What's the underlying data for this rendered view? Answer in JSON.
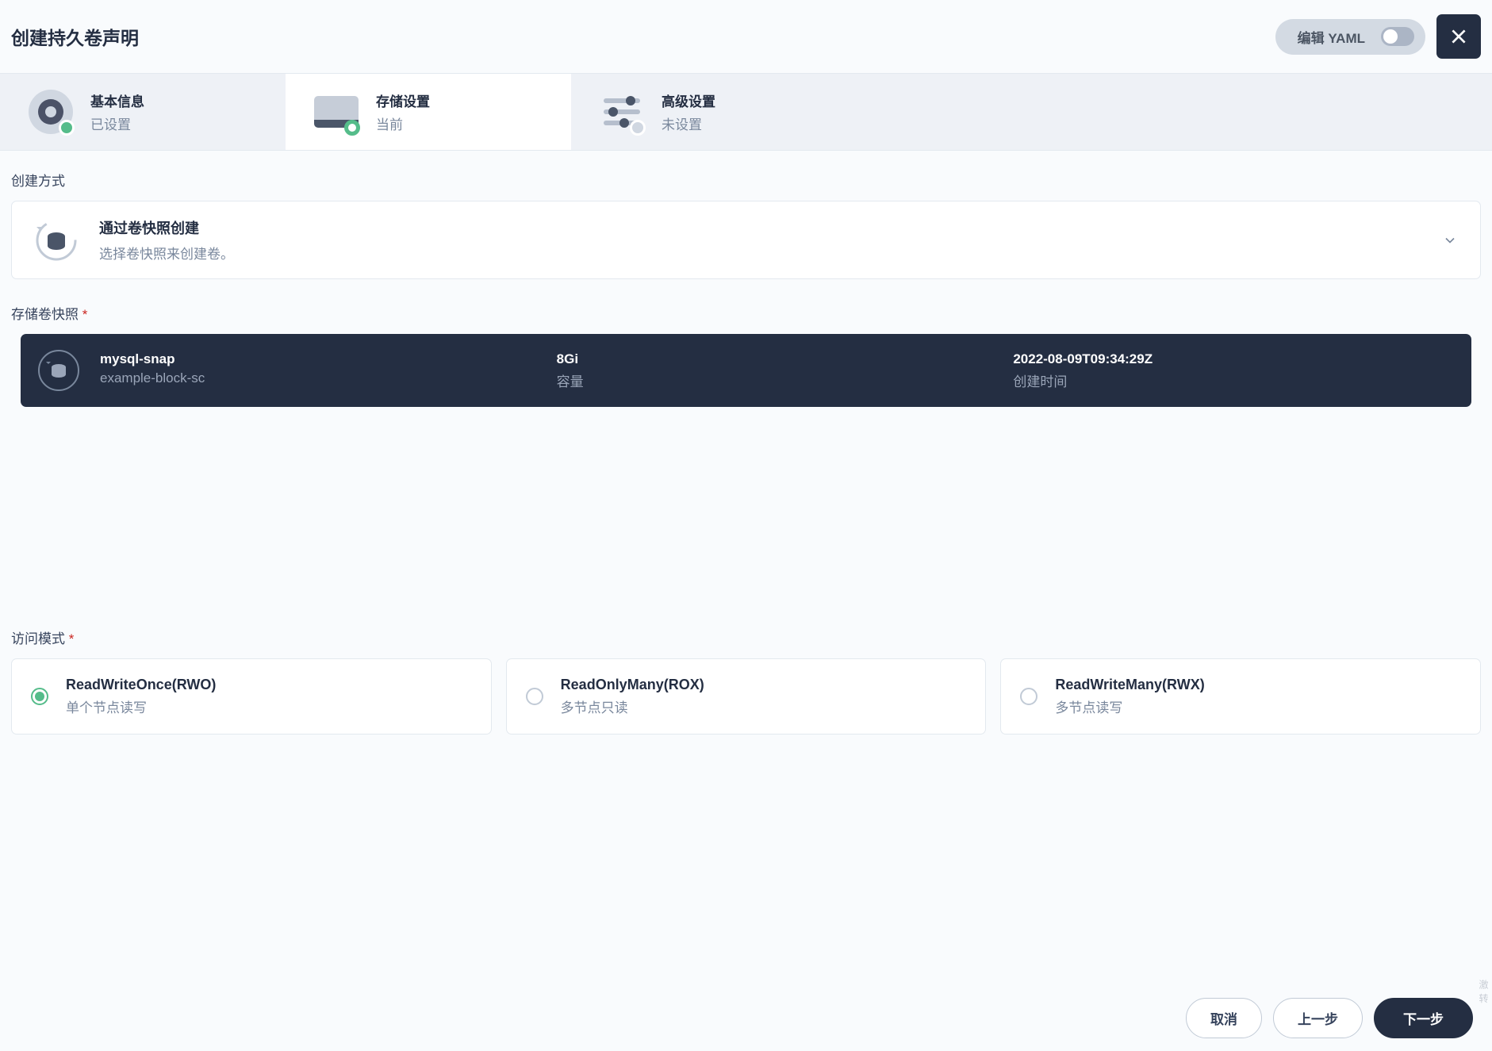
{
  "header": {
    "title": "创建持久卷声明",
    "yaml_label": "编辑 YAML"
  },
  "steps": [
    {
      "title": "基本信息",
      "sub": "已设置"
    },
    {
      "title": "存储设置",
      "sub": "当前"
    },
    {
      "title": "高级设置",
      "sub": "未设置"
    }
  ],
  "labels": {
    "create_method": "创建方式",
    "snapshot_section": "存储卷快照",
    "access_mode": "访问模式"
  },
  "method": {
    "title": "通过卷快照创建",
    "sub": "选择卷快照来创建卷。"
  },
  "snapshot": {
    "name": "mysql-snap",
    "storage_class": "example-block-sc",
    "capacity": "8Gi",
    "capacity_label": "容量",
    "created_at": "2022-08-09T09:34:29Z",
    "created_label": "创建时间"
  },
  "modes": [
    {
      "title": "ReadWriteOnce(RWO)",
      "sub": "单个节点读写",
      "selected": true
    },
    {
      "title": "ReadOnlyMany(ROX)",
      "sub": "多节点只读",
      "selected": false
    },
    {
      "title": "ReadWriteMany(RWX)",
      "sub": "多节点读写",
      "selected": false
    }
  ],
  "footer": {
    "cancel": "取消",
    "prev": "上一步",
    "next": "下一步"
  },
  "watermark": "激 转"
}
